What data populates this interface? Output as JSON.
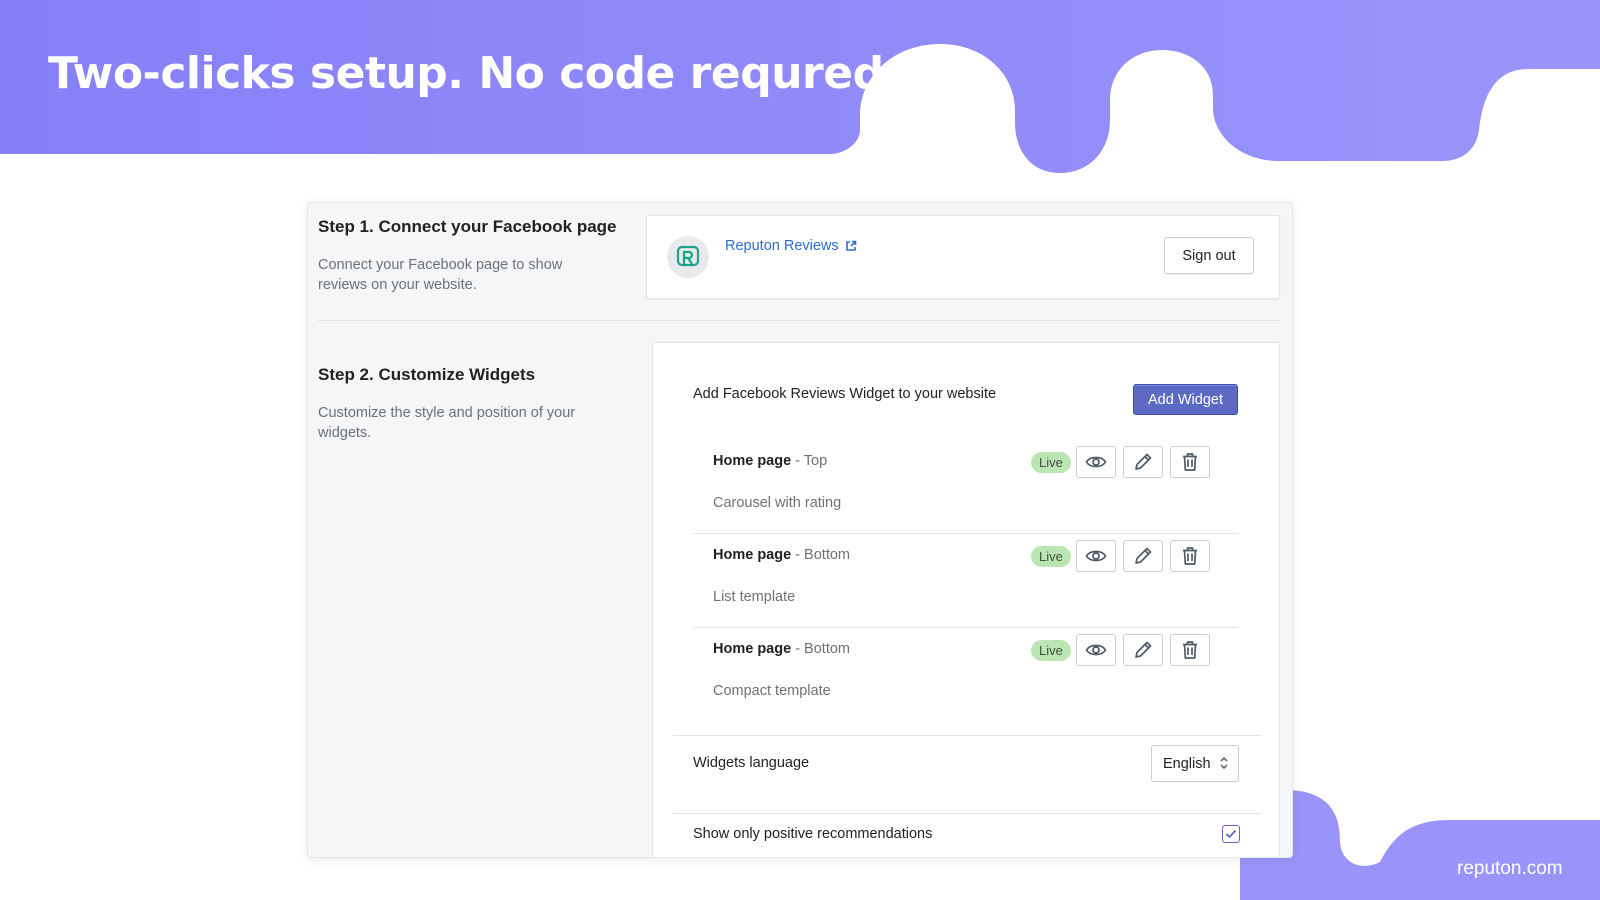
{
  "banner": {
    "headline": "Two-clicks setup. No code requred",
    "site": "reputon.com",
    "color": "#8c86f8"
  },
  "step1": {
    "heading": "Step 1. Connect your Facebook page",
    "description": "Connect your Facebook page to show reviews on your website.",
    "page_name": "Reputon Reviews",
    "sign_out_label": "Sign out"
  },
  "step2": {
    "heading": "Step 2. Customize Widgets",
    "description": "Customize the style and position of your widgets.",
    "card_title": "Add Facebook Reviews Widget to your website",
    "add_widget_label": "Add Widget",
    "widgets": [
      {
        "page": "Home page",
        "position": " - Top",
        "status": "Live",
        "template": "Carousel with rating"
      },
      {
        "page": "Home page",
        "position": " - Bottom",
        "status": "Live",
        "template": "List template"
      },
      {
        "page": "Home page",
        "position": " - Bottom",
        "status": "Live",
        "template": "Compact template"
      }
    ],
    "language_label": "Widgets language",
    "language_value": "English",
    "positive_label": "Show only positive recommendations",
    "positive_checked": true
  },
  "colors": {
    "primary": "#5c6ac4",
    "live_badge": "#bbe5b3",
    "link": "#2c6ecb"
  },
  "icons": {
    "view": "eye-icon",
    "edit": "pencil-icon",
    "delete": "trash-icon",
    "external": "external-link-icon"
  }
}
